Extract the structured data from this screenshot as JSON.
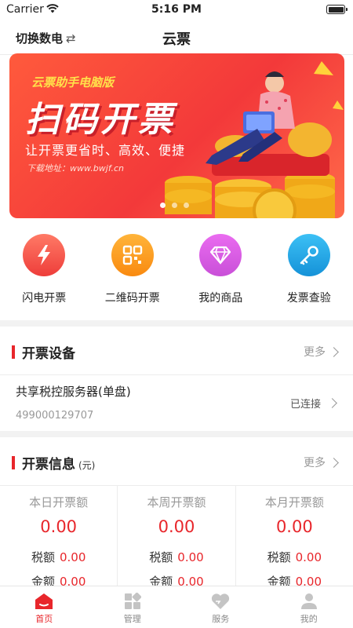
{
  "status_bar": {
    "carrier": "Carrier",
    "time": "5:16 PM"
  },
  "nav": {
    "left_label": "切换数电",
    "swap_glyph": "⇄",
    "title": "云票"
  },
  "banner": {
    "brand": "云票助手电脑版",
    "headline": "扫码开票",
    "subline": "让开票更省时、高效、便捷",
    "download": "下载地址：www.bwjf.cn",
    "active_slide": 1,
    "slide_count": 3
  },
  "quick_actions": [
    {
      "label": "闪电开票",
      "icon": "lightning-icon",
      "color": "#f2534f"
    },
    {
      "label": "二维码开票",
      "icon": "qrcode-icon",
      "color": "#fb9c1d"
    },
    {
      "label": "我的商品",
      "icon": "diamond-icon",
      "color": "#d85ae0"
    },
    {
      "label": "发票查验",
      "icon": "key-icon",
      "color": "#1aa6e6"
    }
  ],
  "device_section": {
    "title": "开票设备",
    "more": "更多",
    "device_name": "共享税控服务器(单盘)",
    "device_id": "499000129707",
    "status": "已连接"
  },
  "info_section": {
    "title": "开票信息",
    "unit": "(元)",
    "more": "更多",
    "columns": [
      {
        "label": "本日开票额",
        "value": "0.00",
        "tax_label": "税额",
        "tax": "0.00",
        "amount_label": "金额",
        "amount": "0.00"
      },
      {
        "label": "本周开票额",
        "value": "0.00",
        "tax_label": "税额",
        "tax": "0.00",
        "amount_label": "金额",
        "amount": "0.00"
      },
      {
        "label": "本月开票额",
        "value": "0.00",
        "tax_label": "税额",
        "tax": "0.00",
        "amount_label": "金额",
        "amount": "0.00"
      }
    ]
  },
  "tabs": [
    {
      "label": "首页",
      "icon": "home-icon",
      "active": true
    },
    {
      "label": "管理",
      "icon": "grid-icon",
      "active": false
    },
    {
      "label": "服务",
      "icon": "heart-icon",
      "active": false
    },
    {
      "label": "我的",
      "icon": "user-icon",
      "active": false
    }
  ],
  "colors": {
    "accent": "#e8262b",
    "muted": "#999999",
    "background": "#f2f2f2"
  }
}
